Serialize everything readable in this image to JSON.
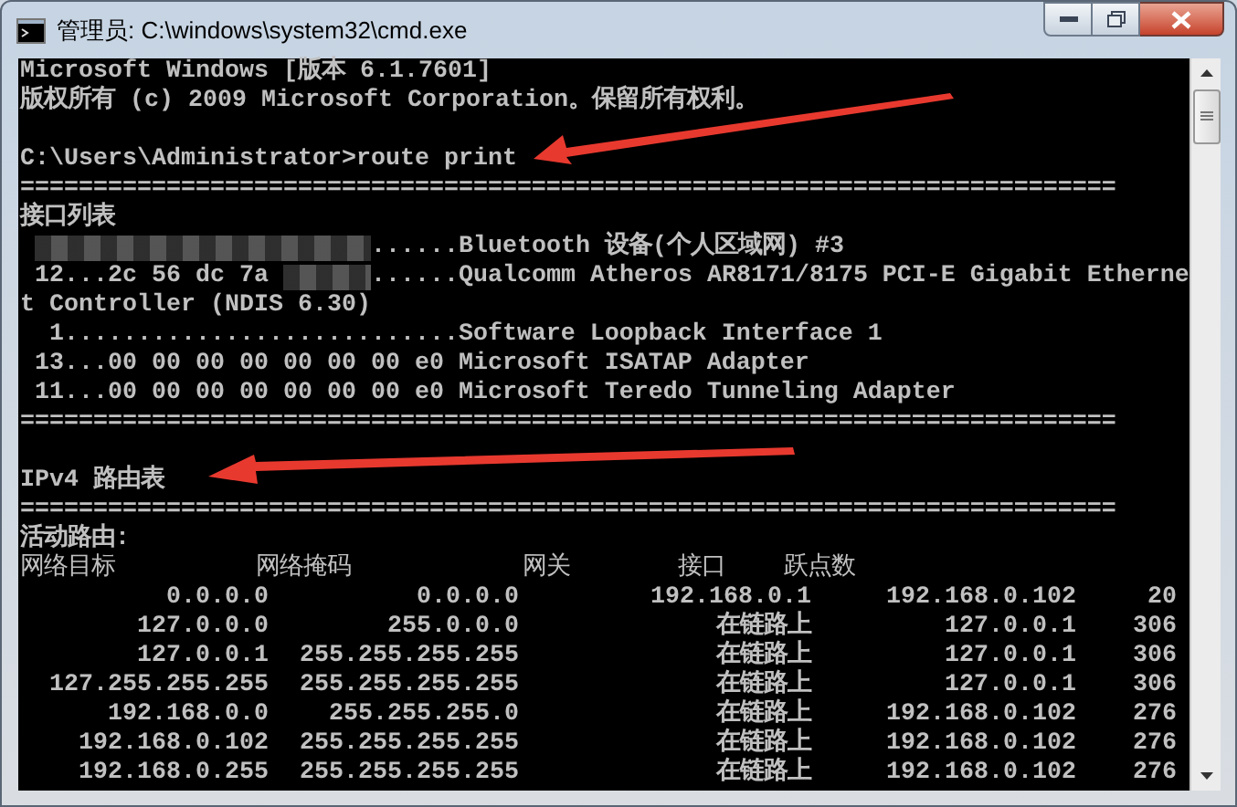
{
  "window": {
    "title": "管理员: C:\\windows\\system32\\cmd.exe"
  },
  "console_lines": [
    {
      "kind": "text",
      "text": "Microsoft Windows [版本 6.1.7601]"
    },
    {
      "kind": "text",
      "text": "版权所有 (c) 2009 Microsoft Corporation。保留所有权利。"
    },
    {
      "kind": "blank"
    },
    {
      "kind": "text",
      "text": "C:\\Users\\Administrator>route print"
    },
    {
      "kind": "text",
      "text": "==========================================================================="
    },
    {
      "kind": "text",
      "text": "接口列表"
    },
    {
      "kind": "masked",
      "after": "......Bluetooth 设备(个人区域网) #3"
    },
    {
      "kind": "masked",
      "before": " 12...2c 56 dc 7a",
      "after": "......Qualcomm Atheros AR8171/8175 PCI-E Gigabit Etherne"
    },
    {
      "kind": "text",
      "text": "t Controller (NDIS 6.30)"
    },
    {
      "kind": "text",
      "text": "  1...........................Software Loopback Interface 1"
    },
    {
      "kind": "text",
      "text": " 13...00 00 00 00 00 00 00 e0 Microsoft ISATAP Adapter"
    },
    {
      "kind": "text",
      "text": " 11...00 00 00 00 00 00 00 e0 Microsoft Teredo Tunneling Adapter"
    },
    {
      "kind": "text",
      "text": "==========================================================================="
    },
    {
      "kind": "blank"
    },
    {
      "kind": "text",
      "text": "IPv4 路由表"
    },
    {
      "kind": "text",
      "text": "==========================================================================="
    },
    {
      "kind": "text",
      "text": "活动路由:"
    }
  ],
  "route_table": {
    "columns": [
      "网络目标",
      "网络掩码",
      "网关",
      "接口",
      "跃点数"
    ],
    "rows": [
      [
        "0.0.0.0",
        "0.0.0.0",
        "192.168.0.1",
        "192.168.0.102",
        "20"
      ],
      [
        "127.0.0.0",
        "255.0.0.0",
        "在链路上",
        "127.0.0.1",
        "306"
      ],
      [
        "127.0.0.1",
        "255.255.255.255",
        "在链路上",
        "127.0.0.1",
        "306"
      ],
      [
        "127.255.255.255",
        "255.255.255.255",
        "在链路上",
        "127.0.0.1",
        "306"
      ],
      [
        "192.168.0.0",
        "255.255.255.0",
        "在链路上",
        "192.168.0.102",
        "276"
      ],
      [
        "192.168.0.102",
        "255.255.255.255",
        "在链路上",
        "192.168.0.102",
        "276"
      ],
      [
        "192.168.0.255",
        "255.255.255.255",
        "在链路上",
        "192.168.0.102",
        "276"
      ]
    ]
  }
}
